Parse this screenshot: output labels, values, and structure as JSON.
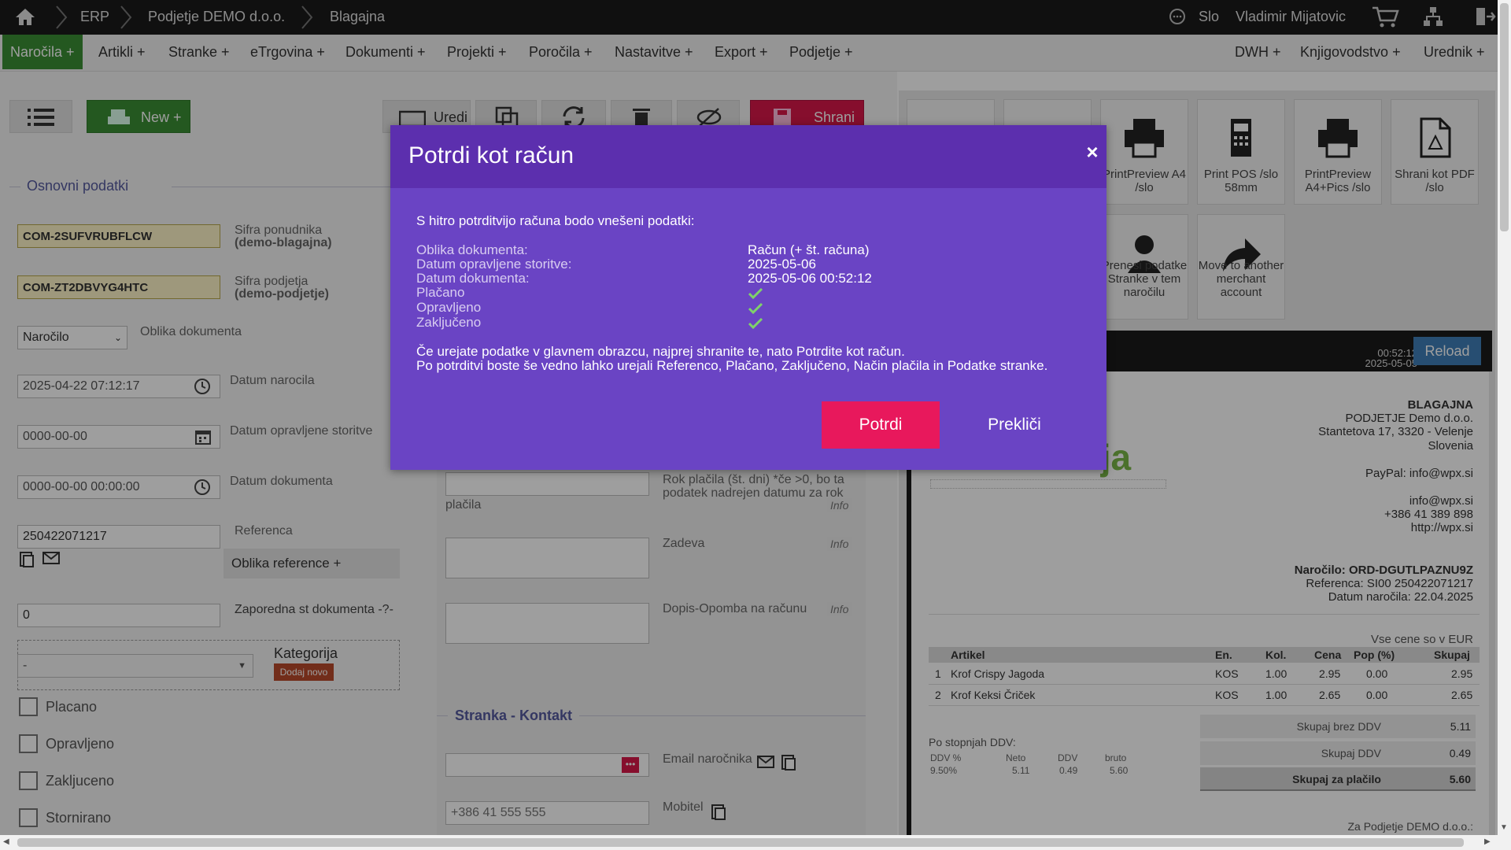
{
  "topbar": {
    "breadcrumbs": [
      "ERP",
      "Podjetje DEMO d.o.o.",
      "Blagajna"
    ],
    "language": "Slo",
    "user": "Vladimir Mijatovic"
  },
  "menu": {
    "left": [
      "Naročila +",
      "Artikli +",
      "Stranke +",
      "eTrgovina +",
      "Dokumenti +",
      "Projekti +",
      "Poročila +",
      "Nastavitve +",
      "Export +",
      "Podjetje +"
    ],
    "right": [
      "DWH +",
      "Knjigovodstvo +",
      "Urednik +"
    ]
  },
  "toolbar": {
    "new_label": "New +",
    "edit_label": "Uredi",
    "save_label": "Shrani"
  },
  "form": {
    "section_basic": "Osnovni podatki",
    "offer_code": "COM-2SUFVRUBFLCW",
    "offer_label": "Sifra ponudnika",
    "offer_sub": "(demo-blagajna)",
    "company_code": "COM-ZT2DBVYG4HTC",
    "company_label": "Sifra podjetja",
    "company_sub": "(demo-podjetje)",
    "doc_type_value": "Naročilo",
    "doc_type_label": "Oblika dokumenta",
    "order_date": "2025-04-22 07:12:17",
    "order_date_label": "Datum narocila",
    "service_date": "0000-00-00",
    "service_date_label": "Datum opravljene storitve",
    "doc_date": "0000-00-00 00:00:00",
    "doc_date_label": "Datum dokumenta",
    "reference": "250422071217",
    "reference_label": "Referenca",
    "reference_form": "Oblika reference +",
    "seq_value": "0",
    "seq_label": "Zaporedna st dokumenta -?-",
    "category_value": "-",
    "category_label": "Kategorija",
    "category_add": "Dodaj novo",
    "checkboxes": [
      "Placano",
      "Opravljeno",
      "Zakljuceno",
      "Stornirano"
    ]
  },
  "middle": {
    "payment_term_label": "Rok plačila (št. dni) *če >0, bo ta podatek nadrejen datumu za rok",
    "payment_word": "plačila",
    "subject_label": "Zadeva",
    "note_label": "Dopis-Opomba na računu",
    "info": "Info",
    "section_contact": "Stranka - Kontakt",
    "email_label": "Email naročnika",
    "mobile_label": "Mobitel",
    "mobile_placeholder": "+386 41 555 555"
  },
  "tiles": [
    {
      "label": "PrintPreview A4 /slo",
      "icon": "printer-icon"
    },
    {
      "label": "Print POS /slo 58mm",
      "icon": "pos-terminal-icon"
    },
    {
      "label": "PrintPreview A4+Pics /slo",
      "icon": "printer-icon"
    },
    {
      "label": "Shrani kot PDF /slo",
      "icon": "pdf-icon"
    },
    {
      "label": "Prenesi podatke Stranke v tem naročilu",
      "icon": "person-icon"
    },
    {
      "label": "Move to another merchant account",
      "icon": "share-arrow-icon"
    }
  ],
  "receipt": {
    "time": "00:52:12",
    "date": "2025-05-05",
    "reload": "Reload",
    "logo_text": "ija",
    "company": [
      "BLAGAJNA",
      "PODJETJE Demo d.o.o.",
      "Stantetova 17, 3320 - Velenje",
      "Slovenia"
    ],
    "paypal": "PayPal: info@wpx.si",
    "contact": [
      "info@wpx.si",
      "+386 41 389 898",
      "http://wpx.si"
    ],
    "order": "Naročilo: ORD-DGUTLPAZNU9Z",
    "reference": "Referenca: SI00 250422071217",
    "order_date": "Datum naročila: 22.04.2025",
    "currency_note": "Vse cene so v EUR",
    "columns": [
      "Artikel",
      "En.",
      "Kol.",
      "Cena",
      "Pop (%)",
      "Skupaj"
    ],
    "rows": [
      [
        "1",
        "Krof Crispy Jagoda",
        "KOS",
        "1.00",
        "2.95",
        "0.00",
        "2.95"
      ],
      [
        "2",
        "Krof Keksi Čriček",
        "KOS",
        "1.00",
        "2.65",
        "0.00",
        "2.65"
      ]
    ],
    "vat_title": "Po stopnjah DDV:",
    "vat_head": [
      "DDV %",
      "Neto",
      "DDV",
      "bruto"
    ],
    "vat_row": [
      "9.50%",
      "5.11",
      "0.49",
      "5.60"
    ],
    "totals": [
      {
        "label": "Skupaj brez DDV",
        "value": "5.11"
      },
      {
        "label": "Skupaj DDV",
        "value": "0.49"
      },
      {
        "label": "Skupaj za plačilo",
        "value": "5.60"
      }
    ],
    "footer": "Za Podjetje DEMO d.o.o.:"
  },
  "modal": {
    "title": "Potrdi kot račun",
    "intro": "S hitro potrditvijo računa bodo vnešeni podatki:",
    "labels": [
      "Oblika dokumenta:",
      "Datum opravljene storitve:",
      "Datum dokumenta:",
      "Plačano",
      "Opravljeno",
      "Zaključeno"
    ],
    "values": [
      "Račun (+ št. računa)",
      "2025-05-06",
      "2025-05-06 00:52:12"
    ],
    "note1": "Če urejate podatke v glavnem obrazcu, najprej shranite te, nato Potrdite kot račun.",
    "note2": "Po potrditvi boste še vedno lahko urejali Referenco, Plačano, Zaključeno, Način plačila in Podatke stranke.",
    "confirm": "Potrdi",
    "cancel": "Prekliči",
    "close": "×"
  },
  "colors": {
    "modal_bg": "#6a44c4",
    "modal_header": "#5c2fae",
    "confirm": "#e8185c",
    "menu_active": "#3a8f34",
    "save": "#d8184a"
  }
}
